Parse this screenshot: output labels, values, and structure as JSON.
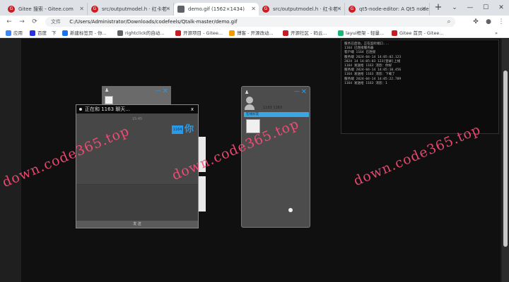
{
  "browser": {
    "tabs": [
      {
        "label": "Gitee 搜索 - Gitee.com",
        "icon": "gitee-icon",
        "active": false
      },
      {
        "label": "src/outputmodel.h · 红卡老 ·",
        "icon": "gitee-icon",
        "active": false
      },
      {
        "label": "demo.gif (1562×1434)",
        "icon": "page-icon",
        "active": true
      },
      {
        "label": "src/outputmodel.h · 红卡老 ·",
        "icon": "gitee-icon",
        "active": false
      },
      {
        "label": "qt5-node-editor: A Qt5 node",
        "icon": "gitee-icon",
        "active": false
      }
    ],
    "new_tab": "+",
    "window_controls": [
      "⌄",
      "—",
      "☐",
      "✕"
    ],
    "nav": {
      "back": "←",
      "forward": "→",
      "reload": "⟳",
      "home": "⌂"
    },
    "address": {
      "badge": "文件",
      "url": "C:/Users/Administrator/Downloads/codefeels/Qtalk-master/demo.gif"
    },
    "bookmarks": [
      {
        "label": "应用",
        "color": "#4285f4"
      },
      {
        "label": "百度",
        "color": "#2932e1"
      },
      {
        "label": "下",
        "color": "#2932e1"
      },
      {
        "label": "新建标签页 - 你...",
        "color": "#1a73e8"
      },
      {
        "label": "rightclick的自动...",
        "color": "#5f6368"
      },
      {
        "label": "开源项目 - Gitee...",
        "color": "#c71d23"
      },
      {
        "label": "博客 - 开源改动...",
        "color": "#f29b00"
      },
      {
        "label": "开源社区 - 码云...",
        "color": "#c71d23"
      },
      {
        "label": "layui框架 - 轻量...",
        "color": "#16b777"
      },
      {
        "label": "Gitee 首页 - Gitee...",
        "color": "#c71d23"
      }
    ]
  },
  "log": {
    "lines": [
      "服务已启动，正在监听端口...",
      "1164 已连接服务器",
      "客户端 1164 已连接",
      "服务端 2024-04-14 14:05:02.123",
      "2024 14 14:05:03 123[登录]上线",
      "1164 发送给 1163 消息：你好",
      "",
      "服务端 2024-04-14 14:05:10.456",
      "1164 发送给 1163 消息：下载了",
      "",
      "服务端 2024-04-14 14:05:22.789",
      "1164 发送给 1163 消息：1"
    ]
  },
  "chat_main": {
    "title": "正在和 1163 聊天...",
    "close": "x",
    "timestamp": "15:45",
    "bubble_tag": "1164",
    "bubble_text": "你",
    "send_label": "发 送"
  },
  "chat_right": {
    "username": "1163 1163",
    "bar_text": "在线好友",
    "close": "✕",
    "minimize": "—"
  },
  "chat_back": {
    "close": "✕",
    "minimize": "—"
  },
  "watermark": "down.code365.top"
}
